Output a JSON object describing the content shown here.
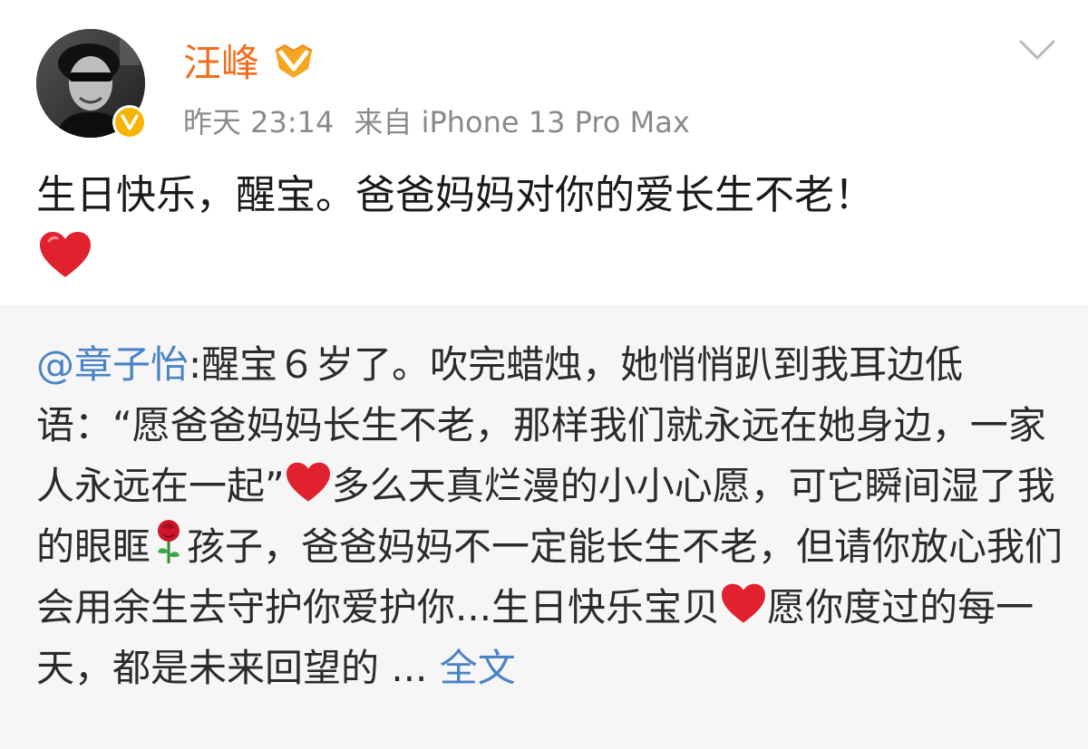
{
  "post": {
    "username": "汪峰",
    "time": "昨天 23:14",
    "source": "来自 iPhone 13 Pro Max",
    "text": "生日快乐，醒宝。爸爸妈妈对你的爱长生不老！",
    "emoji": "heart-icon",
    "colors": {
      "username": "#f26d1b",
      "link": "#4a83c4",
      "badge": "#f7b500",
      "repost_bg": "#f6f6f6"
    }
  },
  "repost": {
    "mention": "@章子怡",
    "seg1": ":醒宝６岁了。吹完蜡烛，她悄悄趴到我耳边低语：“愿爸爸妈妈长生不老，那样我们就永远在她身边，一家人永远在一起”",
    "seg2": "多么天真烂漫的小小心愿，可它瞬间湿了我的眼眶",
    "seg3": "孩子，爸爸妈妈不一定能长生不老，但请你放心我们会用余生去守护你爱护你...生日快乐宝贝",
    "seg4": "愿你度过的每一天，都是未来回望的 ... ",
    "full_text_link": "全文",
    "emojis": [
      "heart-icon",
      "rose-icon",
      "heart-icon"
    ]
  }
}
